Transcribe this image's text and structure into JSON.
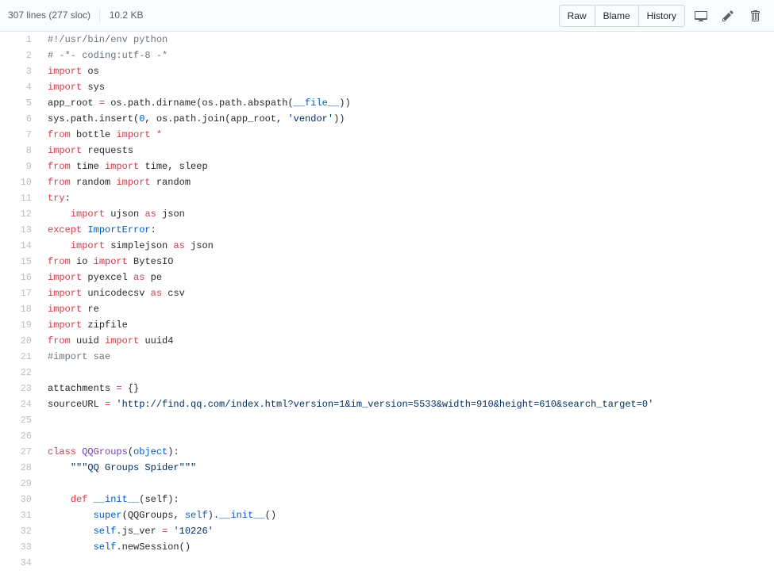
{
  "header": {
    "lines_count": "307 lines (277 sloc)",
    "size": "10.2 KB",
    "raw": "Raw",
    "blame": "Blame",
    "history": "History"
  },
  "code": {
    "l1_c": "#!/usr/bin/env python",
    "l2_c": "# -*- coding:utf-8 -*",
    "l3_k": "import",
    "l3_r": " os",
    "l4_k": "import",
    "l4_r": " sys",
    "l5_a": "app_root ",
    "l5_k1": "=",
    "l5_b": " os.path.dirname(os.path.abspath(",
    "l5_c1": "__file__",
    "l5_c": "))",
    "l6_a": "sys.path.insert(",
    "l6_n": "0",
    "l6_b": ", os.path.join(app_root, ",
    "l6_s": "'vendor'",
    "l6_c": "))",
    "l7_k1": "from",
    "l7_a": " bottle ",
    "l7_k2": "import",
    "l7_b": " ",
    "l7_k3": "*",
    "l8_k": "import",
    "l8_r": " requests",
    "l9_k1": "from",
    "l9_a": " time ",
    "l9_k2": "import",
    "l9_b": " time, sleep",
    "l10_k1": "from",
    "l10_a": " random ",
    "l10_k2": "import",
    "l10_b": " random",
    "l11_k": "try",
    "l11_c": ":",
    "l12_sp": "    ",
    "l12_k1": "import",
    "l12_a": " ujson ",
    "l12_k2": "as",
    "l12_b": " json",
    "l13_k1": "except",
    "l13_a": " ",
    "l13_c1": "ImportError",
    "l13_b": ":",
    "l14_sp": "    ",
    "l14_k1": "import",
    "l14_a": " simplejson ",
    "l14_k2": "as",
    "l14_b": " json",
    "l15_k1": "from",
    "l15_a": " io ",
    "l15_k2": "import",
    "l15_b": " BytesIO",
    "l16_k1": "import",
    "l16_a": " pyexcel ",
    "l16_k2": "as",
    "l16_b": " pe",
    "l17_k1": "import",
    "l17_a": " unicodecsv ",
    "l17_k2": "as",
    "l17_b": " csv",
    "l18_k": "import",
    "l18_r": " re",
    "l19_k": "import",
    "l19_r": " zipfile",
    "l20_k1": "from",
    "l20_a": " uuid ",
    "l20_k2": "import",
    "l20_b": " uuid4",
    "l21_c": "#import sae",
    "l23_a": "attachments ",
    "l23_k": "=",
    "l23_b": " {}",
    "l24_a": "sourceURL ",
    "l24_k": "=",
    "l24_b": " ",
    "l24_s": "'http://find.qq.com/index.html?version=1&im_version=5533&width=910&height=610&search_target=0'",
    "l27_k": "class",
    "l27_a": " ",
    "l27_en": "QQGroups",
    "l27_b": "(",
    "l27_c1": "object",
    "l27_c": "):",
    "l28_sp": "    ",
    "l28_s": "\"\"\"QQ Groups Spider\"\"\"",
    "l30_sp": "    ",
    "l30_k": "def",
    "l30_a": " ",
    "l30_c1": "__init__",
    "l30_b": "(",
    "l30_smi": "self",
    "l30_c": "):",
    "l31_sp": "        ",
    "l31_c1a": "super",
    "l31_a": "(QQGroups, ",
    "l31_c1b": "self",
    "l31_b": ").",
    "l31_c1c": "__init__",
    "l31_c": "()",
    "l32_sp": "        ",
    "l32_c1": "self",
    "l32_a": ".js_ver ",
    "l32_k": "=",
    "l32_b": " ",
    "l32_s": "'10226'",
    "l33_sp": "        ",
    "l33_c1": "self",
    "l33_a": ".newSession()"
  }
}
